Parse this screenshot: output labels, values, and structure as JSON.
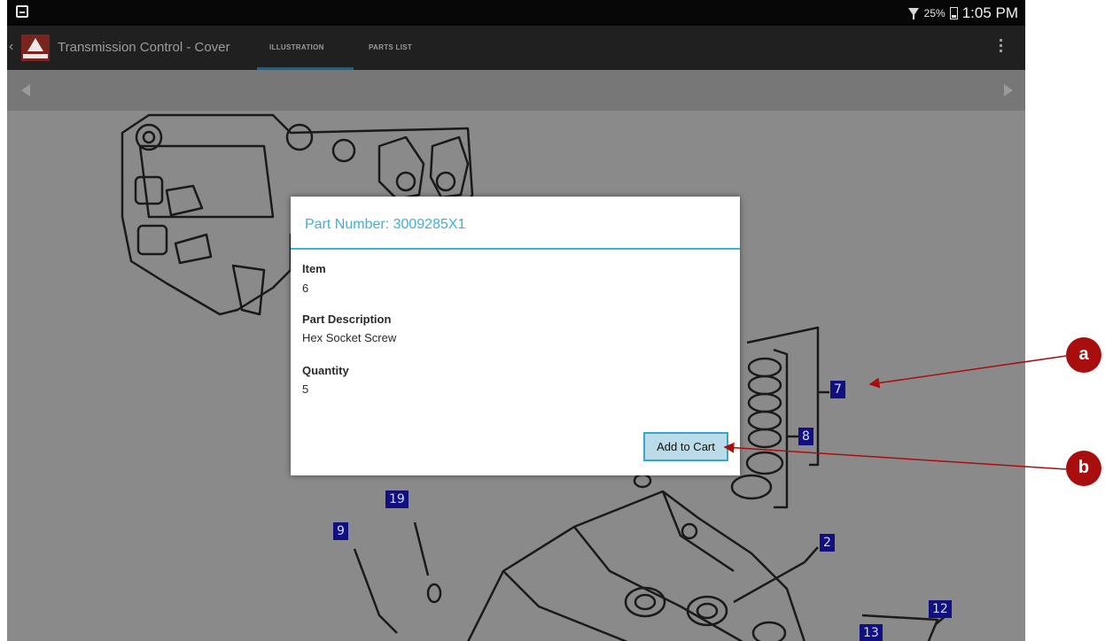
{
  "status_bar": {
    "battery_percent": "25%",
    "time": "1:05 PM",
    "left_icon": "screenshot-icon",
    "icons": [
      "wifi-icon",
      "battery-icon"
    ]
  },
  "action_bar": {
    "title": "Transmission Control - Cover",
    "tabs": [
      {
        "label": "ILLUSTRATION",
        "active": true
      },
      {
        "label": "PARTS LIST",
        "active": false
      }
    ],
    "icons": [
      "back-chevron-icon",
      "brand-logo-icon",
      "overflow-menu-icon"
    ]
  },
  "pager": {
    "icons": [
      "prev-arrow-icon",
      "next-arrow-icon"
    ]
  },
  "illustration": {
    "callouts": [
      "7",
      "8",
      "19",
      "9",
      "2",
      "12",
      "13"
    ]
  },
  "dialog": {
    "title": "Part Number: 3009285X1",
    "fields": [
      {
        "label": "Item",
        "value": "6"
      },
      {
        "label": "Part Description",
        "value": "Hex Socket Screw"
      },
      {
        "label": "Quantity",
        "value": "5"
      }
    ],
    "button_label": "Add to Cart"
  },
  "annotations": {
    "labels": [
      "a",
      "b"
    ],
    "color": "#a80e0e"
  },
  "colors": {
    "accent": "#41b0d8",
    "status_bar": "#070707",
    "action_bar": "#202020",
    "callout_bg": "#101080"
  }
}
